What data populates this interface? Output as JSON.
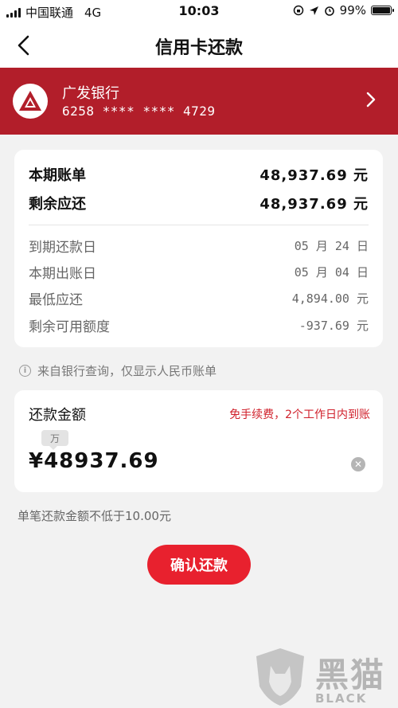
{
  "status_bar": {
    "carrier": "中国联通",
    "network": "4G",
    "time": "10:03",
    "battery": "99%"
  },
  "nav": {
    "title": "信用卡还款",
    "back_icon": "chevron-left-icon"
  },
  "bank": {
    "name": "广发银行",
    "card_number": "6258 **** **** 4729",
    "logo_icon": "bank-logo-icon",
    "chevron_icon": "chevron-right-icon",
    "color": "#b21e2a"
  },
  "bill": {
    "current_label": "本期账单",
    "current_value": "48,937.69 元",
    "remaining_label": "剩余应还",
    "remaining_value": "48,937.69 元",
    "details": [
      {
        "label": "到期还款日",
        "value": "05 月 24 日"
      },
      {
        "label": "本期出账日",
        "value": "05 月 04 日"
      },
      {
        "label": "最低应还",
        "value": "4,894.00 元"
      },
      {
        "label": "剩余可用额度",
        "value": "-937.69 元"
      }
    ]
  },
  "info": {
    "text": "来自银行查询，仅显示人民币账单",
    "icon": "info-icon"
  },
  "payment": {
    "label": "还款金额",
    "note": "免手续费，2个工作日内到账",
    "unit_hint": "万",
    "amount": "¥48937.69",
    "clear_icon": "clear-icon",
    "min_note": "单笔还款金额不低于10.00元"
  },
  "actions": {
    "confirm": "确认还款",
    "accent": "#e8212e"
  },
  "watermark": {
    "title": "黑猫",
    "subtitle": "BLACK CAT"
  }
}
